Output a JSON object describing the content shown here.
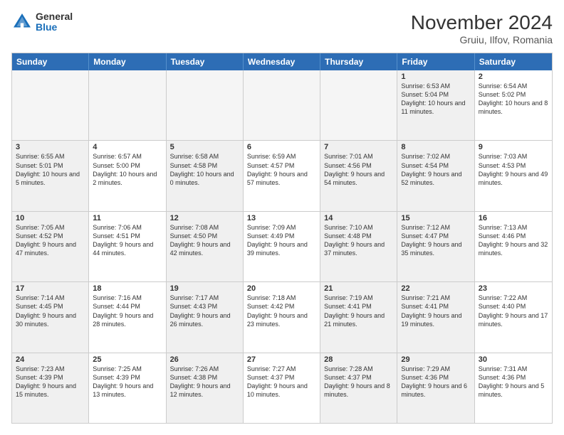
{
  "header": {
    "title": "November 2024",
    "location": "Gruiu, Ilfov, Romania",
    "logo_general": "General",
    "logo_blue": "Blue"
  },
  "days_of_week": [
    "Sunday",
    "Monday",
    "Tuesday",
    "Wednesday",
    "Thursday",
    "Friday",
    "Saturday"
  ],
  "rows": [
    [
      {
        "day": "",
        "text": "",
        "empty": true
      },
      {
        "day": "",
        "text": "",
        "empty": true
      },
      {
        "day": "",
        "text": "",
        "empty": true
      },
      {
        "day": "",
        "text": "",
        "empty": true
      },
      {
        "day": "",
        "text": "",
        "empty": true
      },
      {
        "day": "1",
        "text": "Sunrise: 6:53 AM\nSunset: 5:04 PM\nDaylight: 10 hours and 11 minutes.",
        "shaded": true
      },
      {
        "day": "2",
        "text": "Sunrise: 6:54 AM\nSunset: 5:02 PM\nDaylight: 10 hours and 8 minutes.",
        "shaded": false
      }
    ],
    [
      {
        "day": "3",
        "text": "Sunrise: 6:55 AM\nSunset: 5:01 PM\nDaylight: 10 hours and 5 minutes.",
        "shaded": true
      },
      {
        "day": "4",
        "text": "Sunrise: 6:57 AM\nSunset: 5:00 PM\nDaylight: 10 hours and 2 minutes.",
        "shaded": false
      },
      {
        "day": "5",
        "text": "Sunrise: 6:58 AM\nSunset: 4:58 PM\nDaylight: 10 hours and 0 minutes.",
        "shaded": true
      },
      {
        "day": "6",
        "text": "Sunrise: 6:59 AM\nSunset: 4:57 PM\nDaylight: 9 hours and 57 minutes.",
        "shaded": false
      },
      {
        "day": "7",
        "text": "Sunrise: 7:01 AM\nSunset: 4:56 PM\nDaylight: 9 hours and 54 minutes.",
        "shaded": true
      },
      {
        "day": "8",
        "text": "Sunrise: 7:02 AM\nSunset: 4:54 PM\nDaylight: 9 hours and 52 minutes.",
        "shaded": true
      },
      {
        "day": "9",
        "text": "Sunrise: 7:03 AM\nSunset: 4:53 PM\nDaylight: 9 hours and 49 minutes.",
        "shaded": false
      }
    ],
    [
      {
        "day": "10",
        "text": "Sunrise: 7:05 AM\nSunset: 4:52 PM\nDaylight: 9 hours and 47 minutes.",
        "shaded": true
      },
      {
        "day": "11",
        "text": "Sunrise: 7:06 AM\nSunset: 4:51 PM\nDaylight: 9 hours and 44 minutes.",
        "shaded": false
      },
      {
        "day": "12",
        "text": "Sunrise: 7:08 AM\nSunset: 4:50 PM\nDaylight: 9 hours and 42 minutes.",
        "shaded": true
      },
      {
        "day": "13",
        "text": "Sunrise: 7:09 AM\nSunset: 4:49 PM\nDaylight: 9 hours and 39 minutes.",
        "shaded": false
      },
      {
        "day": "14",
        "text": "Sunrise: 7:10 AM\nSunset: 4:48 PM\nDaylight: 9 hours and 37 minutes.",
        "shaded": true
      },
      {
        "day": "15",
        "text": "Sunrise: 7:12 AM\nSunset: 4:47 PM\nDaylight: 9 hours and 35 minutes.",
        "shaded": true
      },
      {
        "day": "16",
        "text": "Sunrise: 7:13 AM\nSunset: 4:46 PM\nDaylight: 9 hours and 32 minutes.",
        "shaded": false
      }
    ],
    [
      {
        "day": "17",
        "text": "Sunrise: 7:14 AM\nSunset: 4:45 PM\nDaylight: 9 hours and 30 minutes.",
        "shaded": true
      },
      {
        "day": "18",
        "text": "Sunrise: 7:16 AM\nSunset: 4:44 PM\nDaylight: 9 hours and 28 minutes.",
        "shaded": false
      },
      {
        "day": "19",
        "text": "Sunrise: 7:17 AM\nSunset: 4:43 PM\nDaylight: 9 hours and 26 minutes.",
        "shaded": true
      },
      {
        "day": "20",
        "text": "Sunrise: 7:18 AM\nSunset: 4:42 PM\nDaylight: 9 hours and 23 minutes.",
        "shaded": false
      },
      {
        "day": "21",
        "text": "Sunrise: 7:19 AM\nSunset: 4:41 PM\nDaylight: 9 hours and 21 minutes.",
        "shaded": true
      },
      {
        "day": "22",
        "text": "Sunrise: 7:21 AM\nSunset: 4:41 PM\nDaylight: 9 hours and 19 minutes.",
        "shaded": true
      },
      {
        "day": "23",
        "text": "Sunrise: 7:22 AM\nSunset: 4:40 PM\nDaylight: 9 hours and 17 minutes.",
        "shaded": false
      }
    ],
    [
      {
        "day": "24",
        "text": "Sunrise: 7:23 AM\nSunset: 4:39 PM\nDaylight: 9 hours and 15 minutes.",
        "shaded": true
      },
      {
        "day": "25",
        "text": "Sunrise: 7:25 AM\nSunset: 4:39 PM\nDaylight: 9 hours and 13 minutes.",
        "shaded": false
      },
      {
        "day": "26",
        "text": "Sunrise: 7:26 AM\nSunset: 4:38 PM\nDaylight: 9 hours and 12 minutes.",
        "shaded": true
      },
      {
        "day": "27",
        "text": "Sunrise: 7:27 AM\nSunset: 4:37 PM\nDaylight: 9 hours and 10 minutes.",
        "shaded": false
      },
      {
        "day": "28",
        "text": "Sunrise: 7:28 AM\nSunset: 4:37 PM\nDaylight: 9 hours and 8 minutes.",
        "shaded": true
      },
      {
        "day": "29",
        "text": "Sunrise: 7:29 AM\nSunset: 4:36 PM\nDaylight: 9 hours and 6 minutes.",
        "shaded": true
      },
      {
        "day": "30",
        "text": "Sunrise: 7:31 AM\nSunset: 4:36 PM\nDaylight: 9 hours and 5 minutes.",
        "shaded": false
      }
    ]
  ]
}
